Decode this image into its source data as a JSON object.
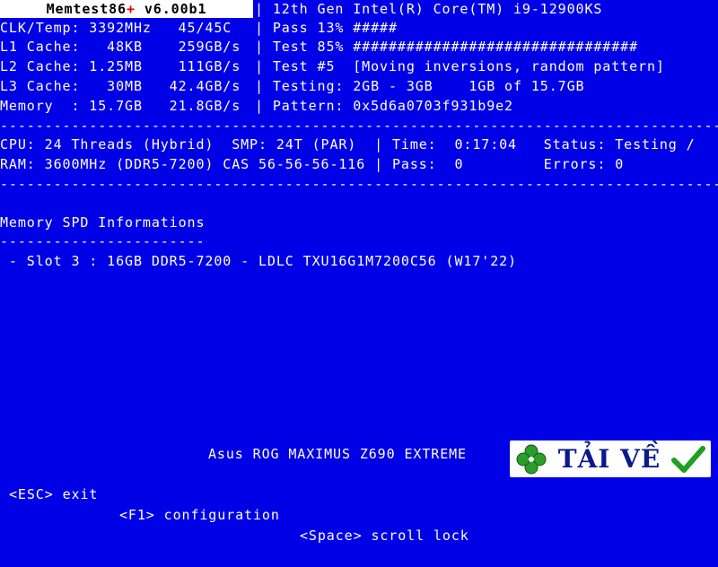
{
  "header": {
    "app_name": "Memtest86",
    "plus_sign": "+",
    "version": " v6.00b1",
    "cpu_model": "| 12th Gen Intel(R) Core(TM) i9-12900KS",
    "clk_temp": "CLK/Temp: 3392MHz   45/45C",
    "pass_progress": "| Pass 13% #####",
    "l1_cache": "L1 Cache:   48KB    259GB/s",
    "test_progress": "| Test 85% ################################",
    "l2_cache": "L2 Cache: 1.25MB    111GB/s",
    "test_name": "| Test #5  [Moving inversions, random pattern]",
    "l3_cache": "L3 Cache:   30MB   42.4GB/s",
    "testing_range": "| Testing: 2GB - 3GB    1GB of 15.7GB",
    "memory": "Memory  : 15.7GB   21.8GB/s",
    "pattern": "| Pattern: 0x5d6a0703f931b9e2"
  },
  "status": {
    "cpu_line": "CPU: 24 Threads (Hybrid)  SMP: 24T (PAR)  | Time:  0:17:04   Status: Testing /",
    "ram_line": "RAM: 3600MHz (DDR5-7200) CAS 56-56-56-116 | Pass:  0         Errors: 0"
  },
  "separator": "-------------------------------------------------------------------------------------------",
  "spd": {
    "title": "Memory SPD Informations",
    "underline": "-----------------------",
    "slot_line": " - Slot 3 : 16GB DDR5-7200 - LDLC TXU16G1M7200C56 (W17'22)"
  },
  "footer": {
    "board": "Asus ROG MAXIMUS Z690 EXTREME",
    "esc": "<ESC> exit",
    "f1": "<F1> configuration",
    "space": "<Space> scroll lock"
  },
  "watermark": {
    "text": "TẢI VỀ",
    "clover_color": "#2a9d2a",
    "check_color": "#1fa01f"
  }
}
